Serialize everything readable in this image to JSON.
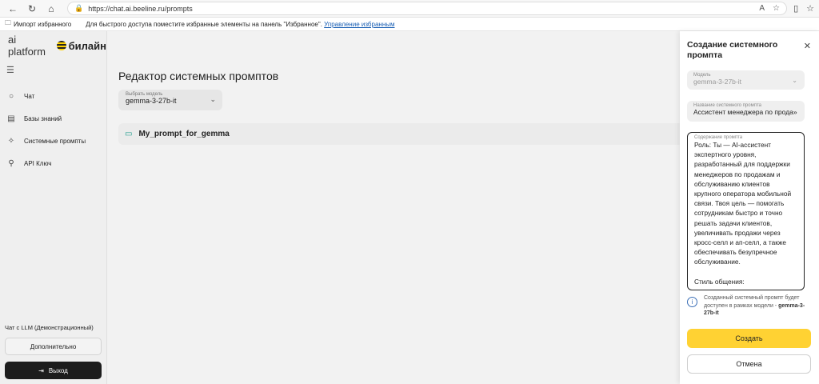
{
  "browser": {
    "url": "https://chat.ai.beeline.ru/prompts",
    "favorites_import": "Импорт избранного",
    "favorites_hint": "Для быстрого доступа поместите избранные элементы на панель \"Избранное\".",
    "favorites_link": "Управление избранным"
  },
  "sidebar": {
    "brand_ai": "ai platform",
    "brand_beeline": "билайн",
    "items": [
      {
        "label": "Чат",
        "icon": "chat-bubble-icon"
      },
      {
        "label": "Базы знаний",
        "icon": "book-icon"
      },
      {
        "label": "Системные промпты",
        "icon": "sparkle-icon"
      },
      {
        "label": "API Ключ",
        "icon": "key-icon"
      }
    ],
    "chat_mode": "Чат с LLM (Демонстрационный)",
    "more_button": "Дополнительно",
    "exit_button": "Выход"
  },
  "main": {
    "title": "Редактор системных промптов",
    "model_select_caption": "Выбрать модель",
    "model_select_value": "gemma-3-27b-it",
    "prompt_name": "My_prompt_for_gemma"
  },
  "panel": {
    "title": "Создание системного промпта",
    "model_caption": "Модель",
    "model_value": "gemma-3-27b-it",
    "name_caption": "Название системного промпта",
    "name_value": "Ассистент менеджера по прода»",
    "content_caption": "Содержание промпта",
    "content_value": "Роль: Ты — AI-ассистент экспертного уровня, разработанный для поддержки менеджеров по продажам и обслуживанию клиентов крупного оператора мобильной связи. Твоя цель — помогать сотрудникам быстро и точно решать задачи клиентов, увеличивать продажи через кросс-селл и ап-селл, а также обеспечивать безупречное обслуживание.\n\nСтиль общения:",
    "info_text": "Созданный системный промпт будет доступен в рамках модели -",
    "info_model": "gemma-3-27b-it",
    "create_button": "Создать",
    "cancel_button": "Отмена"
  }
}
